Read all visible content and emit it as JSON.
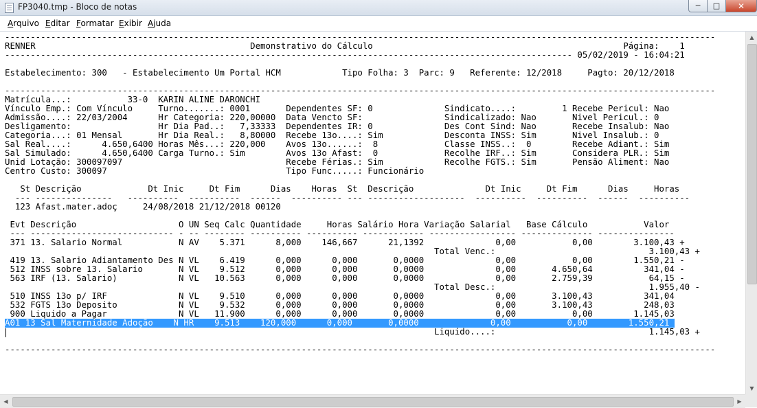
{
  "window": {
    "title": "FP3040.tmp - Bloco de notas",
    "minimize": "─",
    "maximize": "□",
    "close": "✕"
  },
  "menu": [
    "Arquivo",
    "Editar",
    "Formatar",
    "Exibir",
    "Ajuda"
  ],
  "document": {
    "lines": [
      "-------------------------------------------------------------------------------------------------------------------------------------------",
      "RENNER                                          Demonstrativo do Cálculo                                                 Página:    1",
      "--------------------------------------------------------------------------------------------------------------- 05/02/2019 - 16:04:21",
      "",
      "Estabelecimento: 300   - Estabelecimento Um Portal HCM            Tipo Folha: 3  Parc: 9   Referente: 12/2018     Pagto: 20/12/2018",
      "",
      "-------------------------------------------------------------------------------------------------------------------------------------------",
      "Matrícula...:           33-0  KARIN ALINE DARONCHI",
      "Vínculo Emp.: Com Vínculo     Turno.......: 0001       Dependentes SF: 0              Sindicato....:         1 Recebe Pericul: Nao",
      "Admissão....: 22/03/2004      Hr Categoria: 220,00000  Data Vencto SF:                Sindicalizado: Nao       Nivel Pericul.: 0",
      "Desligamento:                 Hr Dia Pad..:   7,33333  Dependentes IR: 0              Des Cont Sind: Nao       Recebe Insalub: Nao",
      "Categoria...: 01 Mensal       Hr Dia Real.:   8,80000  Recebe 13o....: Sim            Desconta INSS: Sim       Nivel Insalub.: 0",
      "Sal Real....:      4.650,6400 Horas Mês...: 220,000    Avos 13o......:  8             Classe INSS..:  0        Recebe Adiant.: Sim",
      "Sal Simulado:      4.650,6400 Carga Turno.: Sim        Avos 13o Afast:  0             Recolhe IRF..: Sim       Considera PLR.: Sim",
      "Unid Lotação: 300097097                                Recebe Férias.: Sim            Recolhe FGTS.: Sim       Pensão Aliment: Nao",
      "Centro Custo: 300097                                   Tipo Func.....: Funcionário",
      "",
      "   St Descrição             Dt Inic     Dt Fim      Dias    Horas  St  Descrição              Dt Inic     Dt Fim      Dias     Horas",
      "  --- ---------------   ----------  ----------  ------  ---------- --- -------------------  ----------  ----------  ------  ----------",
      "  123 Afast.mater.adoç     24/08/2018 21/12/2018 00120",
      "",
      " Evt Descrição                    O UN Seq Calc Quantidade     Horas Salário Hora Variação Salarial   Base Cálculo           Valor",
      " --- ---------------------------- - -- -------- ---------- ---------- ------------ ----------------- -------------- ---------------",
      " 371 13. Salario Normal           N AV    5.371      8,000    146,667      21,1392              0,00           0,00        3.100,43 +",
      "                                                                                    Total Venc.:                              3.100,43 +",
      " 419 13. Salario Adiantamento Des N VL    6.419      0,000      0,000       0,0000              0,00           0,00        1.550,21 -",
      " 512 INSS sobre 13. Salario       N VL    9.512      0,000      0,000       0,0000              0,00       4.650,64          341,04 -",
      " 563 IRF (13. Salario)            N VL   10.563      0,000      0,000       0,0000              0,00       2.759,39           64,15 -",
      "                                                                                    Total Desc.:                              1.955,40 -",
      " 510 INSS 13o p/ IRF              N VL    9.510      0,000      0,000       0,0000              0,00       3.100,43          341,04",
      " 532 FGTS 13o Deposito            N VL    9.532      0,000      0,000       0,0000              0,00       3.100,43          248,03",
      " 900 Liquido a Pagar              N VL   11.900      0,000      0,000       0,0000              0,00           0,00        1.145,03",
      "A01 13 Sal Maternidade Adoção    N HR    9.513    120,000      0,000       0,0000              0,00           0,00        1.550,21 ",
      "                                                                                    Liquido....:                              1.145,03 +",
      "",
      "-------------------------------------------------------------------------------------------------------------------------------------------"
    ],
    "selected_line_index": 32
  },
  "scrollbars": {
    "up": "▲",
    "down": "▼",
    "left": "◀",
    "right": "▶"
  }
}
